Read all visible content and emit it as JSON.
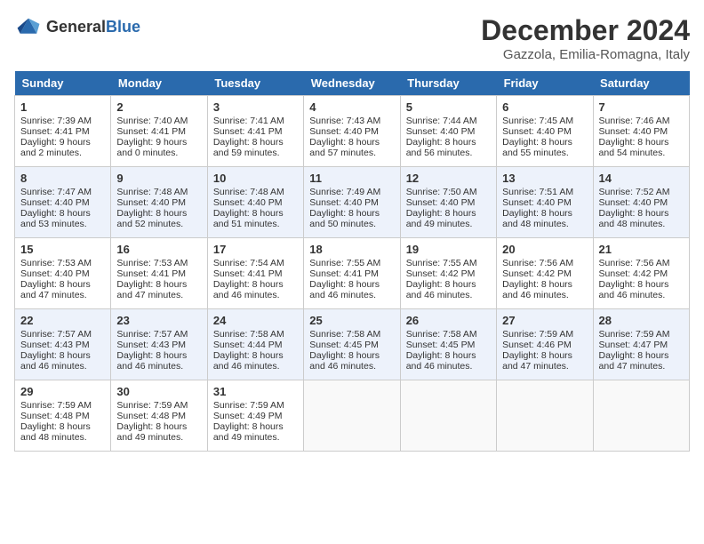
{
  "header": {
    "logo_general": "General",
    "logo_blue": "Blue",
    "month_title": "December 2024",
    "location": "Gazzola, Emilia-Romagna, Italy"
  },
  "weekdays": [
    "Sunday",
    "Monday",
    "Tuesday",
    "Wednesday",
    "Thursday",
    "Friday",
    "Saturday"
  ],
  "weeks": [
    [
      {
        "day": "1",
        "sunrise": "Sunrise: 7:39 AM",
        "sunset": "Sunset: 4:41 PM",
        "daylight": "Daylight: 9 hours and 2 minutes."
      },
      {
        "day": "2",
        "sunrise": "Sunrise: 7:40 AM",
        "sunset": "Sunset: 4:41 PM",
        "daylight": "Daylight: 9 hours and 0 minutes."
      },
      {
        "day": "3",
        "sunrise": "Sunrise: 7:41 AM",
        "sunset": "Sunset: 4:41 PM",
        "daylight": "Daylight: 8 hours and 59 minutes."
      },
      {
        "day": "4",
        "sunrise": "Sunrise: 7:43 AM",
        "sunset": "Sunset: 4:40 PM",
        "daylight": "Daylight: 8 hours and 57 minutes."
      },
      {
        "day": "5",
        "sunrise": "Sunrise: 7:44 AM",
        "sunset": "Sunset: 4:40 PM",
        "daylight": "Daylight: 8 hours and 56 minutes."
      },
      {
        "day": "6",
        "sunrise": "Sunrise: 7:45 AM",
        "sunset": "Sunset: 4:40 PM",
        "daylight": "Daylight: 8 hours and 55 minutes."
      },
      {
        "day": "7",
        "sunrise": "Sunrise: 7:46 AM",
        "sunset": "Sunset: 4:40 PM",
        "daylight": "Daylight: 8 hours and 54 minutes."
      }
    ],
    [
      {
        "day": "8",
        "sunrise": "Sunrise: 7:47 AM",
        "sunset": "Sunset: 4:40 PM",
        "daylight": "Daylight: 8 hours and 53 minutes."
      },
      {
        "day": "9",
        "sunrise": "Sunrise: 7:48 AM",
        "sunset": "Sunset: 4:40 PM",
        "daylight": "Daylight: 8 hours and 52 minutes."
      },
      {
        "day": "10",
        "sunrise": "Sunrise: 7:48 AM",
        "sunset": "Sunset: 4:40 PM",
        "daylight": "Daylight: 8 hours and 51 minutes."
      },
      {
        "day": "11",
        "sunrise": "Sunrise: 7:49 AM",
        "sunset": "Sunset: 4:40 PM",
        "daylight": "Daylight: 8 hours and 50 minutes."
      },
      {
        "day": "12",
        "sunrise": "Sunrise: 7:50 AM",
        "sunset": "Sunset: 4:40 PM",
        "daylight": "Daylight: 8 hours and 49 minutes."
      },
      {
        "day": "13",
        "sunrise": "Sunrise: 7:51 AM",
        "sunset": "Sunset: 4:40 PM",
        "daylight": "Daylight: 8 hours and 48 minutes."
      },
      {
        "day": "14",
        "sunrise": "Sunrise: 7:52 AM",
        "sunset": "Sunset: 4:40 PM",
        "daylight": "Daylight: 8 hours and 48 minutes."
      }
    ],
    [
      {
        "day": "15",
        "sunrise": "Sunrise: 7:53 AM",
        "sunset": "Sunset: 4:40 PM",
        "daylight": "Daylight: 8 hours and 47 minutes."
      },
      {
        "day": "16",
        "sunrise": "Sunrise: 7:53 AM",
        "sunset": "Sunset: 4:41 PM",
        "daylight": "Daylight: 8 hours and 47 minutes."
      },
      {
        "day": "17",
        "sunrise": "Sunrise: 7:54 AM",
        "sunset": "Sunset: 4:41 PM",
        "daylight": "Daylight: 8 hours and 46 minutes."
      },
      {
        "day": "18",
        "sunrise": "Sunrise: 7:55 AM",
        "sunset": "Sunset: 4:41 PM",
        "daylight": "Daylight: 8 hours and 46 minutes."
      },
      {
        "day": "19",
        "sunrise": "Sunrise: 7:55 AM",
        "sunset": "Sunset: 4:42 PM",
        "daylight": "Daylight: 8 hours and 46 minutes."
      },
      {
        "day": "20",
        "sunrise": "Sunrise: 7:56 AM",
        "sunset": "Sunset: 4:42 PM",
        "daylight": "Daylight: 8 hours and 46 minutes."
      },
      {
        "day": "21",
        "sunrise": "Sunrise: 7:56 AM",
        "sunset": "Sunset: 4:42 PM",
        "daylight": "Daylight: 8 hours and 46 minutes."
      }
    ],
    [
      {
        "day": "22",
        "sunrise": "Sunrise: 7:57 AM",
        "sunset": "Sunset: 4:43 PM",
        "daylight": "Daylight: 8 hours and 46 minutes."
      },
      {
        "day": "23",
        "sunrise": "Sunrise: 7:57 AM",
        "sunset": "Sunset: 4:43 PM",
        "daylight": "Daylight: 8 hours and 46 minutes."
      },
      {
        "day": "24",
        "sunrise": "Sunrise: 7:58 AM",
        "sunset": "Sunset: 4:44 PM",
        "daylight": "Daylight: 8 hours and 46 minutes."
      },
      {
        "day": "25",
        "sunrise": "Sunrise: 7:58 AM",
        "sunset": "Sunset: 4:45 PM",
        "daylight": "Daylight: 8 hours and 46 minutes."
      },
      {
        "day": "26",
        "sunrise": "Sunrise: 7:58 AM",
        "sunset": "Sunset: 4:45 PM",
        "daylight": "Daylight: 8 hours and 46 minutes."
      },
      {
        "day": "27",
        "sunrise": "Sunrise: 7:59 AM",
        "sunset": "Sunset: 4:46 PM",
        "daylight": "Daylight: 8 hours and 47 minutes."
      },
      {
        "day": "28",
        "sunrise": "Sunrise: 7:59 AM",
        "sunset": "Sunset: 4:47 PM",
        "daylight": "Daylight: 8 hours and 47 minutes."
      }
    ],
    [
      {
        "day": "29",
        "sunrise": "Sunrise: 7:59 AM",
        "sunset": "Sunset: 4:48 PM",
        "daylight": "Daylight: 8 hours and 48 minutes."
      },
      {
        "day": "30",
        "sunrise": "Sunrise: 7:59 AM",
        "sunset": "Sunset: 4:48 PM",
        "daylight": "Daylight: 8 hours and 49 minutes."
      },
      {
        "day": "31",
        "sunrise": "Sunrise: 7:59 AM",
        "sunset": "Sunset: 4:49 PM",
        "daylight": "Daylight: 8 hours and 49 minutes."
      },
      null,
      null,
      null,
      null
    ]
  ]
}
